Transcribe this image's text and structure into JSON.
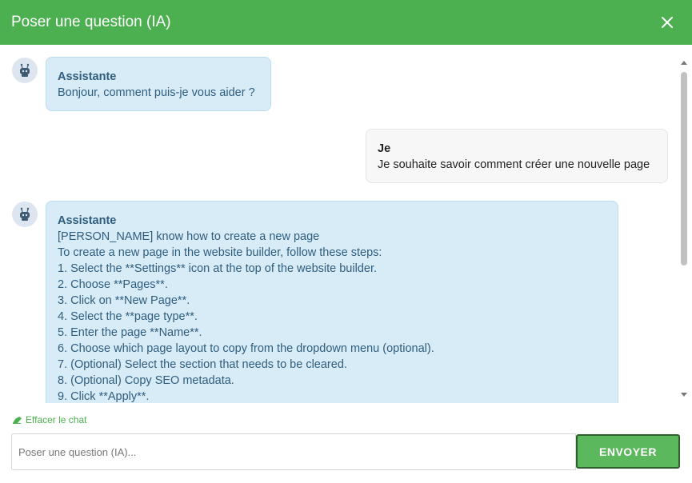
{
  "header": {
    "title": "Poser une question (IA)",
    "close_icon": "close-icon"
  },
  "messages": [
    {
      "sender": "Assistante",
      "role": "ai",
      "lines": [
        "Bonjour, comment puis-je vous aider ?"
      ]
    },
    {
      "sender": "Je",
      "role": "me",
      "lines": [
        "Je souhaite savoir comment créer une nouvelle page"
      ]
    },
    {
      "sender": "Assistante",
      "role": "ai",
      "lines": [
        "[PERSON_NAME] know how to create a new page",
        "To create a new page in the website builder, follow these steps:",
        "1. Select the **Settings** icon at the top of the website builder.",
        "2. Choose **Pages**.",
        "3. Click on **New Page**.",
        "4. Select the **page type**.",
        "5. Enter the page **Name**.",
        "6. Choose which page layout to copy from the dropdown menu (optional).",
        "7. (Optional) Select the section that needs to be cleared.",
        "8. (Optional) Copy SEO metadata.",
        "9. Click **Apply**."
      ]
    }
  ],
  "footer": {
    "clear_label": "Effacer le chat",
    "input_placeholder": "Poser une question (IA)...",
    "send_label": "ENVOYER"
  },
  "colors": {
    "header": "#4caf50",
    "ai_bubble": "#d8ecf7",
    "me_bubble": "#f7f7f7",
    "send_button": "#5cb85c"
  }
}
